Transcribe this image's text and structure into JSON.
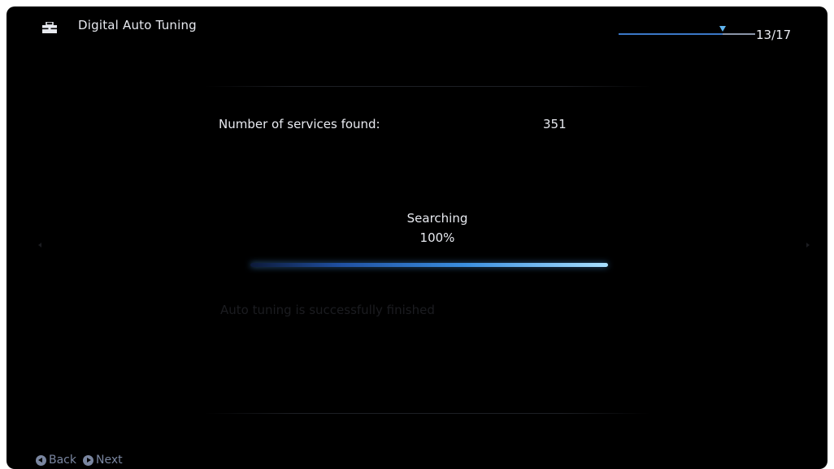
{
  "header": {
    "title": "Digital Auto Tuning",
    "icon": "toolbox-icon",
    "step_counter": "13/17",
    "step_current": 13,
    "step_total": 17
  },
  "results": {
    "services_label": "Number of services found:",
    "services_value": "351"
  },
  "progress": {
    "status_label": "Searching",
    "percent_label": "100%",
    "percent": 100
  },
  "message": "Auto tuning is successfully finished",
  "footer": {
    "back_label": "Back",
    "next_label": "Next"
  },
  "colors": {
    "background": "#000000",
    "text": "#e8eaf0",
    "accent": "#3b8fe0",
    "progress_glow": "#a9e0ff",
    "footer_text": "#7a86a0"
  }
}
